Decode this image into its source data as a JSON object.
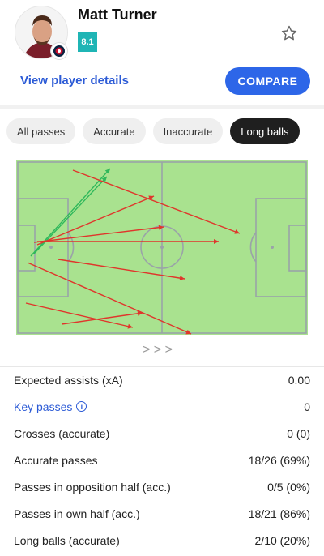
{
  "player": {
    "name": "Matt Turner",
    "rating": "8.1",
    "details_link": "View player details",
    "compare_label": "COMPARE"
  },
  "filters": [
    "All passes",
    "Accurate",
    "Inaccurate",
    "Long balls"
  ],
  "active_filter": "Long balls",
  "pitch": {
    "grass_color": "#a9e28f",
    "line_color": "#9aa3a8",
    "accurate_color": "#2fb85b",
    "inaccurate_color": "#e0352b"
  },
  "pagination_arrows": "> > >",
  "stats": [
    {
      "label": "Expected assists (xA)",
      "value": "0.00"
    },
    {
      "label": "Key passes",
      "value": "0"
    },
    {
      "label": "Crosses (accurate)",
      "value": "0 (0)"
    },
    {
      "label": "Accurate passes",
      "value": "18/26 (69%)"
    },
    {
      "label": "Passes in opposition half (acc.)",
      "value": "0/5 (0%)"
    },
    {
      "label": "Passes in own half (acc.)",
      "value": "18/21 (86%)"
    },
    {
      "label": "Long balls (accurate)",
      "value": "2/10 (20%)"
    }
  ]
}
